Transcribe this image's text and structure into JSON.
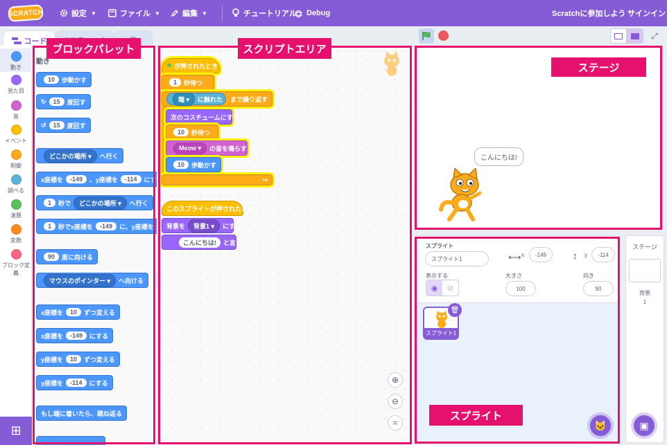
{
  "menubar": {
    "logo": "SCRATCH",
    "settings": "設定",
    "file": "ファイル",
    "edit": "編集",
    "tutorials": "チュートリアル",
    "debug": "Debug",
    "join": "Scratchに参加しよう",
    "signin": "サインイン"
  },
  "tabs": {
    "code": "コード",
    "costumes": "コスチューム",
    "sounds": "音"
  },
  "categories": [
    {
      "label": "動き",
      "color": "#4c97ff"
    },
    {
      "label": "見た目",
      "color": "#9966ff"
    },
    {
      "label": "音",
      "color": "#cf63cf"
    },
    {
      "label": "イベント",
      "color": "#ffbf00"
    },
    {
      "label": "制御",
      "color": "#ffab19"
    },
    {
      "label": "調べる",
      "color": "#5cb1d6"
    },
    {
      "label": "演算",
      "color": "#59c059"
    },
    {
      "label": "変数",
      "color": "#ff8c1a"
    },
    {
      "label": "ブロック定義",
      "color": "#ff6680"
    }
  ],
  "palette": {
    "heading": "動き",
    "move_val": "10",
    "move_txt": "歩動かす",
    "turn_r_val": "15",
    "turn_r_txt": "度回す",
    "turn_l_val": "15",
    "turn_l_txt": "度回す",
    "goto_drop": "どこかの場所",
    "goto_txt": "へ行く",
    "gotoxy_a": "x座標を",
    "gotoxy_x": "-149",
    "gotoxy_b": "、y座標を",
    "gotoxy_y": "-114",
    "gotoxy_c": "にする",
    "glide_val": "1",
    "glide_a": "秒で",
    "glide_drop": "どこかの場所",
    "glide_b": "へ行く",
    "glidexy_val": "1",
    "glidexy_a": "秒でx座標を",
    "glidexy_x": "-149",
    "glidexy_b": "に、y座標を",
    "point_val": "90",
    "point_txt": "度に向ける",
    "pointto_drop": "マウスのポインター",
    "pointto_txt": "へ向ける",
    "chx_a": "x座標を",
    "chx_val": "10",
    "chx_b": "ずつ変える",
    "setx_a": "x座標を",
    "setx_val": "-149",
    "setx_b": "にする",
    "chy_a": "y座標を",
    "chy_val": "10",
    "chy_b": "ずつ変える",
    "sety_a": "y座標を",
    "sety_val": "-114",
    "sety_b": "にする",
    "bounce": "もし端に着いたら、跳ね返る"
  },
  "script": {
    "when_flag": "が押されたとき",
    "wait1_val": "1",
    "wait1_txt": "秒待つ",
    "touch_drop": "端",
    "touch_txt": "に触れた",
    "repeat_txt": "まで繰り返す",
    "next_costume": "次のコスチュームにする",
    "wait2_val": "10",
    "wait2_txt": "秒待つ",
    "sound_drop": "Meow",
    "sound_txt": "の音を鳴らす",
    "move_val": "10",
    "move_txt": "歩動かす",
    "when_clicked": "このスプライトが押されたとき",
    "backdrop_a": "背景を",
    "backdrop_drop": "背景1",
    "backdrop_b": "にする",
    "say_val": "こんにちは!",
    "say_txt": "と言う"
  },
  "stage": {
    "bubble": "こんにちは!"
  },
  "sprite_info": {
    "sprite_label": "スプライト",
    "sprite_name": "スプライト1",
    "x_label": "x",
    "x_value": "-149",
    "y_label": "y",
    "y_value": "-114",
    "show_label": "表示する",
    "size_label": "大きさ",
    "size_value": "100",
    "dir_label": "向き",
    "dir_value": "90",
    "thumb_name": "スプライト1"
  },
  "stage_target": {
    "title": "ステージ",
    "backdrops_label": "背景",
    "backdrops_count": "1"
  },
  "annotations": {
    "palette": "ブロックパレット",
    "script": "スクリプトエリア",
    "stage": "ステージ",
    "sprite": "スプライト"
  }
}
